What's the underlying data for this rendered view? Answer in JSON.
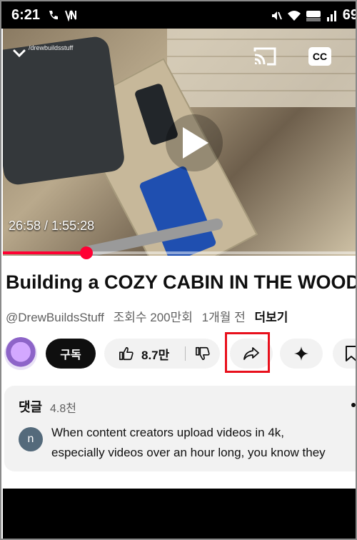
{
  "status_bar": {
    "time": "6:21",
    "battery": "69"
  },
  "video": {
    "watermark": "/drewbuildsstuff",
    "cc_label": "CC",
    "time_readout": "26:58 / 1:55:28",
    "progress": 0.236
  },
  "title": "Building a COZY CABIN IN THE WOODS",
  "meta": {
    "channel": "@DrewBuildsStuff",
    "views": "조회수 200만회",
    "age": "1개월 전",
    "more": "더보기"
  },
  "actions": {
    "subscribe_label": "구독",
    "like_count": "8.7만"
  },
  "comments": {
    "label": "댓글",
    "count": "4.8천",
    "commenter_initial": "n",
    "text_line1": "When content creators upload videos in 4k,",
    "text_line2": "especially videos over an hour long, you know they"
  },
  "colors": {
    "accent_red": "#ff0033",
    "highlight_box": "#e8101c"
  }
}
